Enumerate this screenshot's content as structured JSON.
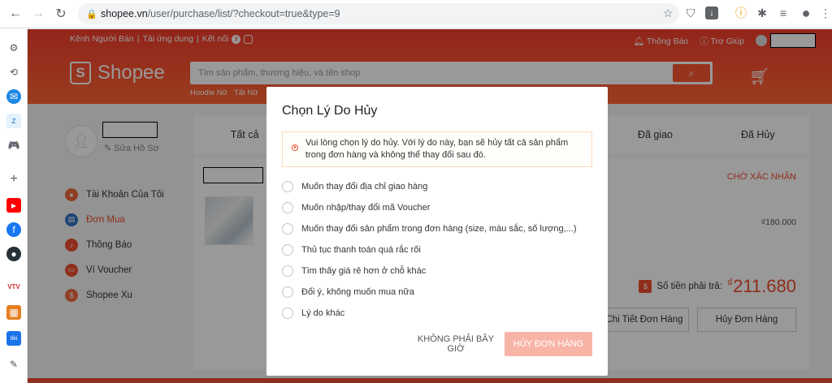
{
  "browser": {
    "url_host": "shopee.vn",
    "url_path": "/user/purchase/list/?checkout=true&type=9"
  },
  "header": {
    "topnav": [
      "Kênh Người Bán",
      "|",
      "Tải ứng dụng",
      "|",
      "Kết nối"
    ],
    "notifications": "Thông Báo",
    "help": "Trợ Giúp",
    "logo": "Shopee",
    "search_placeholder": "Tìm sản phẩm, thương hiệu, và tên shop",
    "suggestions": [
      "Hoodie Nữ",
      "Tất Nữ"
    ]
  },
  "account": {
    "edit_profile": "Sửa Hồ Sơ",
    "nav": [
      {
        "label": "Tài Khoản Của Tôi",
        "color": "#f06a3b"
      },
      {
        "label": "Đơn Mua",
        "color": "#2f72c4"
      },
      {
        "label": "Thông Báo",
        "color": "#ee4d2d"
      },
      {
        "label": "Ví Voucher",
        "color": "#ee4d2d"
      },
      {
        "label": "Shopee Xu",
        "color": "#f06a3b"
      }
    ]
  },
  "tabs": [
    "Tất cả",
    "",
    "",
    "",
    "Đã giao",
    "Đã Hủy"
  ],
  "order": {
    "status": "CHỜ XÁC NHẬN",
    "price": "₫180.000",
    "total_label": "Số tiền phải trả:",
    "total_currency": "₫",
    "total_value": "211.680",
    "detail_button": "Chi Tiết Đơn Hàng",
    "cancel_button": "Hủy Đơn Hàng"
  },
  "modal": {
    "title": "Chọn Lý Do Hủy",
    "notice": "Vui lòng chọn lý do hủy. Với lý do này, bạn sẽ hủy tất cả sản phẩm trong đơn hàng và không thể thay đổi sau đó.",
    "reasons": [
      "Muốn thay đổi địa chỉ giao hàng",
      "Muốn nhập/thay đổi mã Voucher",
      "Muốn thay đổi sản phẩm trong đơn hàng (size, màu sắc, số lượng,...)",
      "Thủ tục thanh toán quá rắc rối",
      "Tìm thấy giá rẻ hơn ở chỗ khác",
      "Đổi ý, không muốn mua nữa",
      "Lý do khác"
    ],
    "not_now": "KHÔNG PHẢI BÂY GIỜ",
    "confirm": "HỦY ĐƠN HÀNG"
  },
  "colors": {
    "brand": "#ee4d2d",
    "brand_disabled": "#f8b5a7"
  }
}
